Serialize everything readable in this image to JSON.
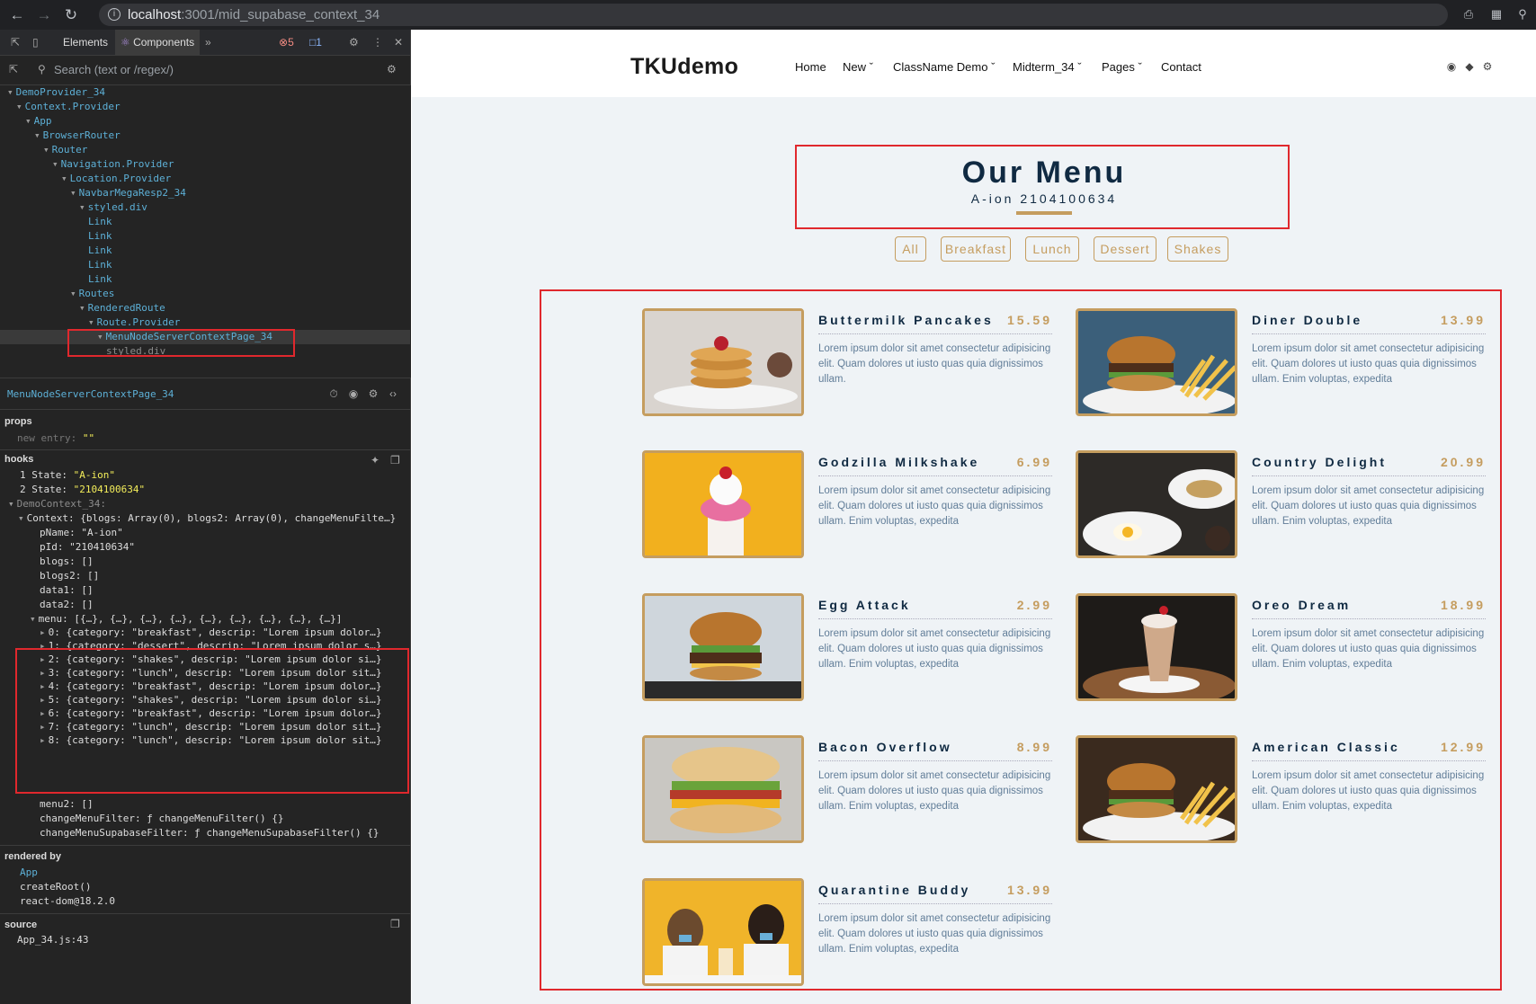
{
  "browser": {
    "url_host": "localhost",
    "url_path": ":3001/mid_supabase_context_34"
  },
  "devtools": {
    "tabs": [
      "Elements",
      "Components"
    ],
    "errors": "5",
    "messages": "1",
    "search_placeholder": "Search (text or /regex/)",
    "tree": [
      {
        "label": "DemoProvider_34",
        "indent": 0
      },
      {
        "label": "Context.Provider",
        "indent": 1
      },
      {
        "label": "App",
        "indent": 2
      },
      {
        "label": "BrowserRouter",
        "indent": 3
      },
      {
        "label": "Router",
        "indent": 4
      },
      {
        "label": "Navigation.Provider",
        "indent": 5
      },
      {
        "label": "Location.Provider",
        "indent": 6
      },
      {
        "label": "NavbarMegaResp2_34",
        "indent": 7
      },
      {
        "label": "styled.div",
        "indent": 8
      },
      {
        "label": "Link",
        "indent": 9
      },
      {
        "label": "Link",
        "indent": 9
      },
      {
        "label": "Link",
        "indent": 9
      },
      {
        "label": "Link",
        "indent": 9
      },
      {
        "label": "Link",
        "indent": 9
      },
      {
        "label": "Routes",
        "indent": 7
      },
      {
        "label": "RenderedRoute",
        "indent": 8
      },
      {
        "label": "Route.Provider",
        "indent": 9
      },
      {
        "label": "MenuNodeServerContextPage_34",
        "indent": 10
      },
      {
        "label": "styled.div",
        "indent": 11
      }
    ],
    "selected_component": "MenuNodeServerContextPage_34",
    "props_title": "props",
    "props_new_entry_key": "new entry",
    "props_new_entry_value": "\"\"",
    "hooks_title": "hooks",
    "state1_label": "1 State:",
    "state1_value": "\"A-ion\"",
    "state2_label": "2 State:",
    "state2_value": "\"2104100634\"",
    "context_name": "DemoContext_34:",
    "context_line": "Context: {blogs: Array(0), blogs2: Array(0), changeMenuFilte…}",
    "pname": "pName: \"A-ion\"",
    "pid": "pId: \"210410634\"",
    "blogs": "blogs: []",
    "blogs2": "blogs2: []",
    "data1": "data1: []",
    "data2": "data2: []",
    "menu_line": "menu: [{…}, {…}, {…}, {…}, {…}, {…}, {…}, {…}, {…}]",
    "menu_entries": [
      "0: {category: \"breakfast\", descrip: \"Lorem ipsum dolor…}",
      "1: {category: \"dessert\", descrip: \"Lorem ipsum dolor s…}",
      "2: {category: \"shakes\", descrip: \"Lorem ipsum dolor si…}",
      "3: {category: \"lunch\", descrip: \"Lorem ipsum dolor sit…}",
      "4: {category: \"breakfast\", descrip: \"Lorem ipsum dolor…}",
      "5: {category: \"shakes\", descrip: \"Lorem ipsum dolor si…}",
      "6: {category: \"breakfast\", descrip: \"Lorem ipsum dolor…}",
      "7: {category: \"lunch\", descrip: \"Lorem ipsum dolor sit…}",
      "8: {category: \"lunch\", descrip: \"Lorem ipsum dolor sit…}"
    ],
    "menu2": "menu2: []",
    "change_filter": "changeMenuFilter: ƒ changeMenuFilter() {}",
    "change_supabase_filter": "changeMenuSupabaseFilter: ƒ changeMenuSupabaseFilter() {}",
    "rendered_by_title": "rendered by",
    "rendered_by": [
      "App",
      "createRoot()",
      "react-dom@18.2.0"
    ],
    "source_title": "source",
    "source": "App_34.js:43"
  },
  "site": {
    "brand": "TKUdemo",
    "nav": [
      "Home",
      "New",
      "ClassName Demo",
      "Midterm_34",
      "Pages",
      "Contact"
    ],
    "title": "Our Menu",
    "subtitle": "A-ion 2104100634",
    "filters": [
      "All",
      "Breakfast",
      "Lunch",
      "Dessert",
      "Shakes"
    ],
    "accent_color": "#c59d5f",
    "items": [
      {
        "name": "Buttermilk Pancakes",
        "price": "15.59",
        "desc": "Lorem ipsum dolor sit amet consectetur adipisicing elit. Quam dolores ut iusto quas quia dignissimos ullam.",
        "img": "pancakes"
      },
      {
        "name": "Diner Double",
        "price": "13.99",
        "desc": "Lorem ipsum dolor sit amet consectetur adipisicing elit. Quam dolores ut iusto quas quia dignissimos ullam. Enim voluptas, expedita",
        "img": "burger-fries"
      },
      {
        "name": "Godzilla Milkshake",
        "price": "6.99",
        "desc": "Lorem ipsum dolor sit amet consectetur adipisicing elit. Quam dolores ut iusto quas quia dignissimos ullam. Enim voluptas, expedita",
        "img": "milkshake"
      },
      {
        "name": "Country Delight",
        "price": "20.99",
        "desc": "Lorem ipsum dolor sit amet consectetur adipisicing elit. Quam dolores ut iusto quas quia dignissimos ullam. Enim voluptas, expedita",
        "img": "breakfast-plate"
      },
      {
        "name": "Egg Attack",
        "price": "2.99",
        "desc": "Lorem ipsum dolor sit amet consectetur adipisicing elit. Quam dolores ut iusto quas quia dignissimos ullam. Enim voluptas, expedita",
        "img": "burger"
      },
      {
        "name": "Oreo Dream",
        "price": "18.99",
        "desc": "Lorem ipsum dolor sit amet consectetur adipisicing elit. Quam dolores ut iusto quas quia dignissimos ullam. Enim voluptas, expedita",
        "img": "oreo-shake"
      },
      {
        "name": "Bacon Overflow",
        "price": "8.99",
        "desc": "Lorem ipsum dolor sit amet consectetur adipisicing elit. Quam dolores ut iusto quas quia dignissimos ullam. Enim voluptas, expedita",
        "img": "bacon-sandwich"
      },
      {
        "name": "American Classic",
        "price": "12.99",
        "desc": "Lorem ipsum dolor sit amet consectetur adipisicing elit. Quam dolores ut iusto quas quia dignissimos ullam. Enim voluptas, expedita",
        "img": "burger-fries-2"
      },
      {
        "name": "Quarantine Buddy",
        "price": "13.99",
        "desc": "Lorem ipsum dolor sit amet consectetur adipisicing elit. Quam dolores ut iusto quas quia dignissimos ullam. Enim voluptas, expedita",
        "img": "couple-shake"
      }
    ]
  }
}
